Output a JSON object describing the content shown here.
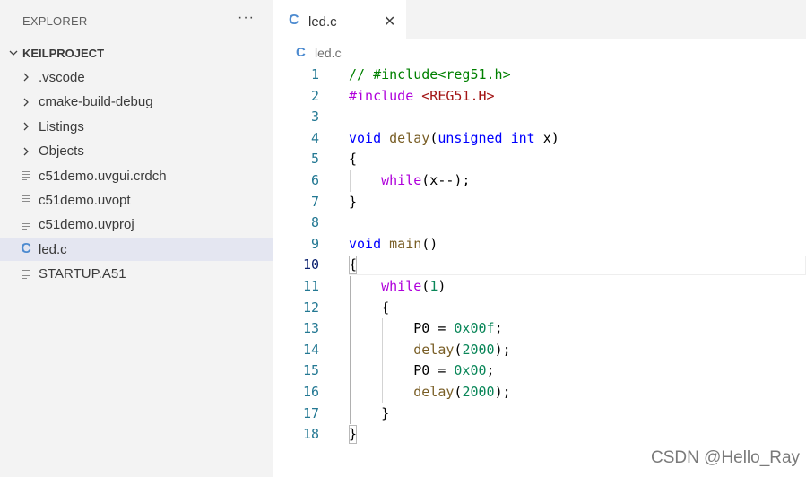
{
  "explorer": {
    "title": "EXPLORER",
    "more_label": "···",
    "items": [
      {
        "label": "KEILPROJECT",
        "icon": "chevron-down-icon",
        "kind": "root"
      },
      {
        "label": ".vscode",
        "icon": "chevron-right-icon",
        "kind": "folder"
      },
      {
        "label": "cmake-build-debug",
        "icon": "chevron-right-icon",
        "kind": "folder"
      },
      {
        "label": "Listings",
        "icon": "chevron-right-icon",
        "kind": "folder"
      },
      {
        "label": "Objects",
        "icon": "chevron-right-icon",
        "kind": "folder"
      },
      {
        "label": "c51demo.uvgui.crdch",
        "icon": "file-lines-icon",
        "kind": "file"
      },
      {
        "label": "c51demo.uvopt",
        "icon": "file-lines-icon",
        "kind": "file"
      },
      {
        "label": "c51demo.uvproj",
        "icon": "file-lines-icon",
        "kind": "file"
      },
      {
        "label": "led.c",
        "icon": "c-file-icon",
        "kind": "file",
        "selected": true
      },
      {
        "label": "STARTUP.A51",
        "icon": "file-lines-icon",
        "kind": "file"
      }
    ]
  },
  "tab": {
    "label": "led.c",
    "icon_glyph": "C",
    "close_glyph": "✕"
  },
  "breadcrumb": {
    "label": "led.c",
    "icon_glyph": "C"
  },
  "editor": {
    "active_line": 10,
    "lines": [
      {
        "n": "1",
        "tokens": [
          {
            "t": "// #include<reg51.h>",
            "c": "comment"
          }
        ]
      },
      {
        "n": "2",
        "tokens": [
          {
            "t": "#include",
            "c": "ctrl"
          },
          {
            "t": " ",
            "c": "plain"
          },
          {
            "t": "<REG51.H>",
            "c": "str"
          }
        ]
      },
      {
        "n": "3",
        "tokens": []
      },
      {
        "n": "4",
        "tokens": [
          {
            "t": "void",
            "c": "kw"
          },
          {
            "t": " ",
            "c": "plain"
          },
          {
            "t": "delay",
            "c": "fn"
          },
          {
            "t": "(",
            "c": "plain"
          },
          {
            "t": "unsigned",
            "c": "kw"
          },
          {
            "t": " ",
            "c": "plain"
          },
          {
            "t": "int",
            "c": "kw"
          },
          {
            "t": " x)",
            "c": "plain"
          }
        ]
      },
      {
        "n": "5",
        "tokens": [
          {
            "t": "{",
            "c": "plain"
          }
        ]
      },
      {
        "n": "6",
        "tokens": [
          {
            "t": "    ",
            "c": "plain"
          },
          {
            "t": "while",
            "c": "ctrl"
          },
          {
            "t": "(x--);",
            "c": "plain"
          }
        ]
      },
      {
        "n": "7",
        "tokens": [
          {
            "t": "}",
            "c": "plain"
          }
        ]
      },
      {
        "n": "8",
        "tokens": []
      },
      {
        "n": "9",
        "tokens": [
          {
            "t": "void",
            "c": "kw"
          },
          {
            "t": " ",
            "c": "plain"
          },
          {
            "t": "main",
            "c": "fn"
          },
          {
            "t": "()",
            "c": "plain"
          }
        ]
      },
      {
        "n": "10",
        "tokens": [
          {
            "t": "{",
            "c": "plain"
          }
        ]
      },
      {
        "n": "11",
        "tokens": [
          {
            "t": "    ",
            "c": "plain"
          },
          {
            "t": "while",
            "c": "ctrl"
          },
          {
            "t": "(",
            "c": "plain"
          },
          {
            "t": "1",
            "c": "num"
          },
          {
            "t": ")",
            "c": "plain"
          }
        ]
      },
      {
        "n": "12",
        "tokens": [
          {
            "t": "    {",
            "c": "plain"
          }
        ]
      },
      {
        "n": "13",
        "tokens": [
          {
            "t": "        P0 = ",
            "c": "plain"
          },
          {
            "t": "0x00f",
            "c": "num"
          },
          {
            "t": ";",
            "c": "plain"
          }
        ]
      },
      {
        "n": "14",
        "tokens": [
          {
            "t": "        ",
            "c": "plain"
          },
          {
            "t": "delay",
            "c": "fn"
          },
          {
            "t": "(",
            "c": "plain"
          },
          {
            "t": "2000",
            "c": "num"
          },
          {
            "t": ");",
            "c": "plain"
          }
        ]
      },
      {
        "n": "15",
        "tokens": [
          {
            "t": "        P0 = ",
            "c": "plain"
          },
          {
            "t": "0x00",
            "c": "num"
          },
          {
            "t": ";",
            "c": "plain"
          }
        ]
      },
      {
        "n": "16",
        "tokens": [
          {
            "t": "        ",
            "c": "plain"
          },
          {
            "t": "delay",
            "c": "fn"
          },
          {
            "t": "(",
            "c": "plain"
          },
          {
            "t": "2000",
            "c": "num"
          },
          {
            "t": ");",
            "c": "plain"
          }
        ]
      },
      {
        "n": "17",
        "tokens": [
          {
            "t": "    }",
            "c": "plain"
          }
        ]
      },
      {
        "n": "18",
        "tokens": [
          {
            "t": "}",
            "c": "plain"
          }
        ]
      }
    ]
  },
  "watermark": "CSDN @Hello_Ray",
  "colors": {
    "comment": "#008000",
    "keyword": "#0000ff",
    "control": "#af00db",
    "function": "#795e26",
    "number": "#098658",
    "string": "#a31515",
    "line_number": "#237893",
    "c_icon": "#4d8bd0",
    "selection": "#e4e6f1"
  }
}
